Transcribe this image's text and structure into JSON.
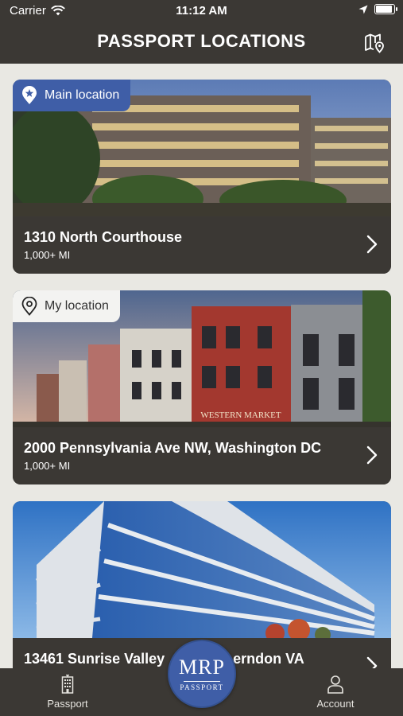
{
  "status_bar": {
    "carrier": "Carrier",
    "time": "11:12 AM"
  },
  "header": {
    "title": "PASSPORT LOCATIONS",
    "map_icon": "map-pin-icon"
  },
  "locations": [
    {
      "badge": "Main location",
      "badge_icon": "star-pin-icon",
      "name": "1310 North Courthouse",
      "distance": "1,000+ MI"
    },
    {
      "badge": "My location",
      "badge_icon": "location-pin-icon",
      "name": "2000 Pennsylvania Ave NW, Washington DC",
      "distance": "1,000+ MI",
      "image_sign": "WESTERN MARKET"
    },
    {
      "name": "13461 Sunrise Valley",
      "name_suffix": "erndon VA"
    }
  ],
  "tab_bar": {
    "passport_label": "Passport",
    "account_label": "Account",
    "logo_main": "MRP",
    "logo_sub": "PASSPORT"
  },
  "colors": {
    "header_bg": "#3b3834",
    "accent_blue": "#3f5ea7",
    "page_bg": "#e9e8e3"
  }
}
